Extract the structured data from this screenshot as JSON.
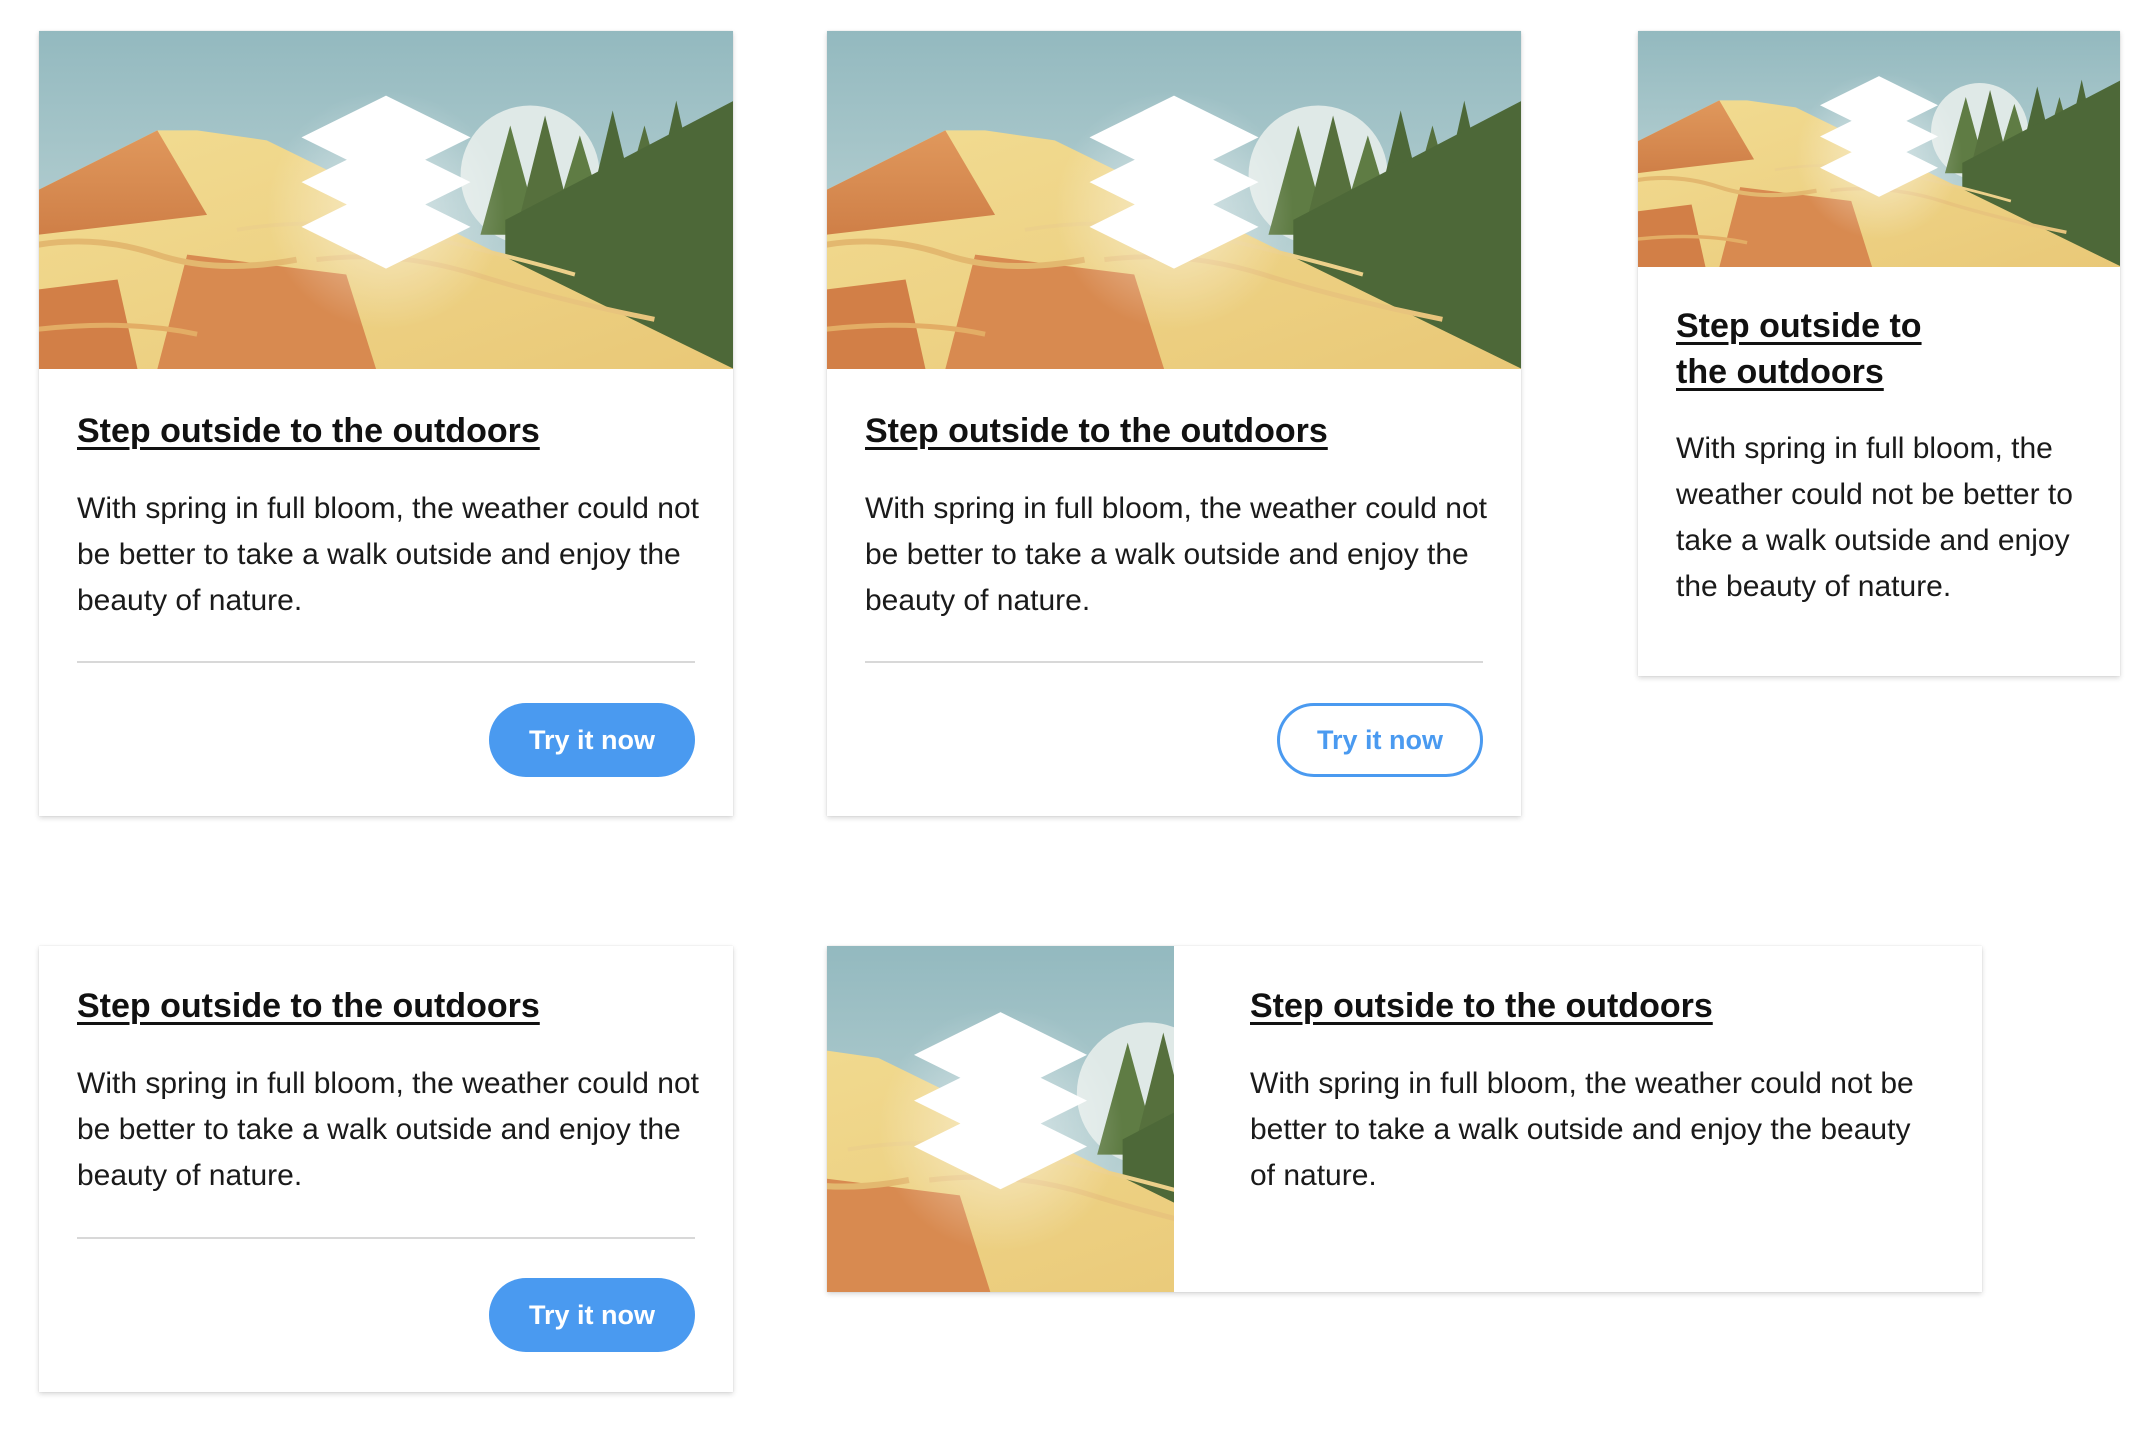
{
  "colors": {
    "accent": "#4a9af0",
    "sky": "#9bc1c6",
    "sand": "#f0d88a",
    "rock": "#d98b52",
    "forest": "#56703d"
  },
  "cards": [
    {
      "variant": "vertical, filled button",
      "image_icon": "layers-icon",
      "title": "Step outside to the outdoors",
      "body": "With spring in full bloom, the weather could not be better to take a walk outside and enjoy the beauty of nature.",
      "button_label": "Try it now"
    },
    {
      "variant": "vertical, outlined button",
      "image_icon": "layers-icon",
      "title": "Step outside to the outdoors",
      "body": "With spring in full bloom, the weather could not be better to take a walk outside and enjoy the beauty of nature.",
      "button_label": "Try it now"
    },
    {
      "variant": "narrow, no button",
      "image_icon": "layers-icon",
      "title": "Step outside to the outdoors",
      "body": "With spring in full bloom, the weather could not be better to take a walk outside and enjoy the beauty of nature."
    },
    {
      "variant": "no image, filled button",
      "title": "Step outside to the outdoors",
      "body": "With spring in full bloom, the weather could not be better to take a walk outside and enjoy the beauty of nature.",
      "button_label": "Try it now"
    },
    {
      "variant": "horizontal, image left",
      "image_icon": "layers-icon",
      "title": "Step outside to the outdoors",
      "body": "With spring in full bloom, the weather could not be better to take a walk outside and enjoy the beauty of nature."
    }
  ]
}
